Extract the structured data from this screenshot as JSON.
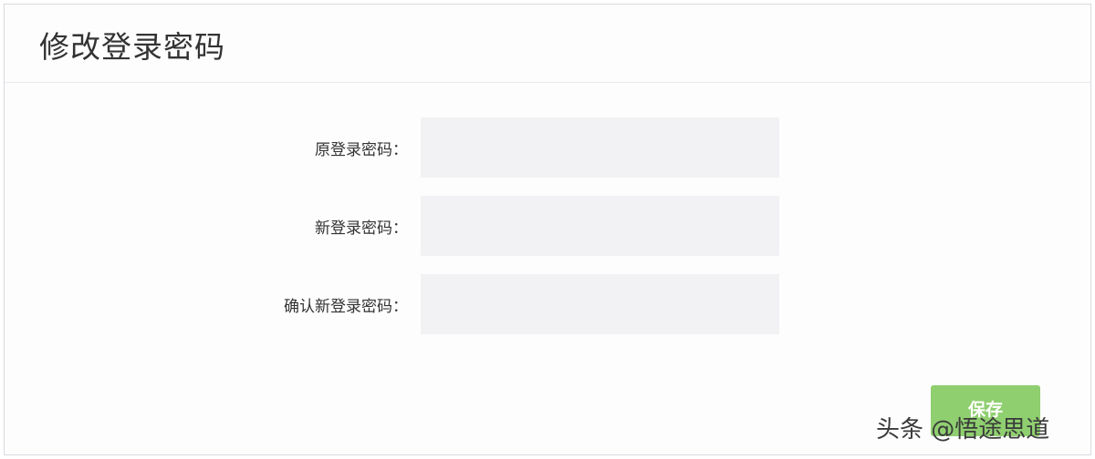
{
  "page": {
    "title": "修改登录密码"
  },
  "form": {
    "old_password": {
      "label": "原登录密码：",
      "value": ""
    },
    "new_password": {
      "label": "新登录密码：",
      "value": ""
    },
    "confirm_password": {
      "label": "确认新登录密码：",
      "value": ""
    }
  },
  "actions": {
    "save_label": "保存",
    "save_color": "#8fcf70"
  },
  "watermark": "头条 @悟途思道"
}
